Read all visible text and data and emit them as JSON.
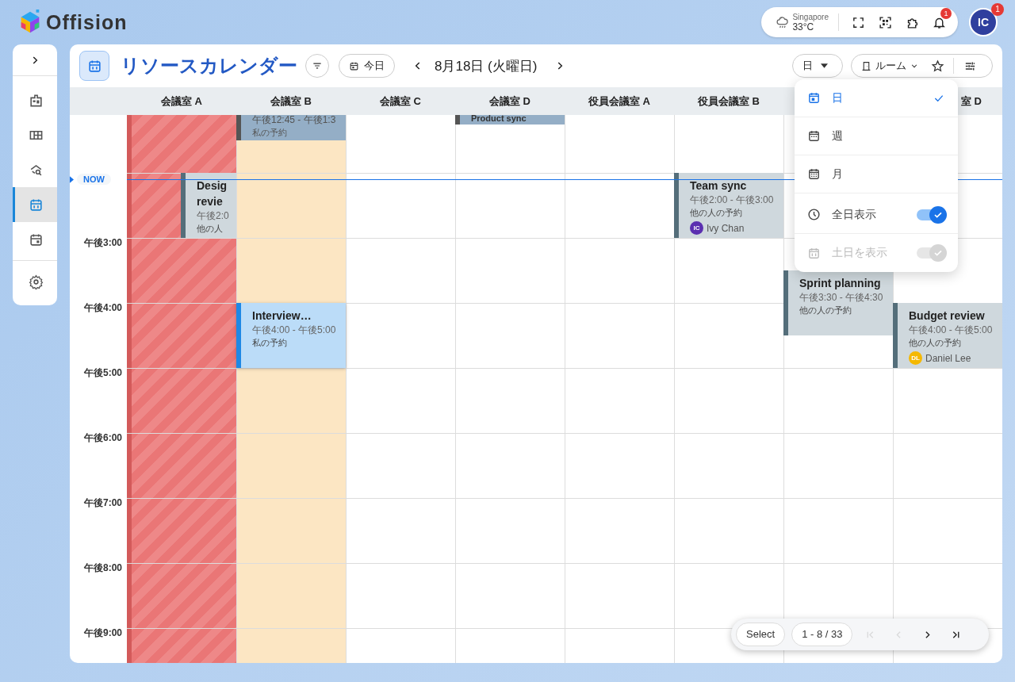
{
  "app": {
    "name": "Offision"
  },
  "weather": {
    "city": "Singapore",
    "temp": "33°C"
  },
  "notifications": {
    "count": "1"
  },
  "user": {
    "initials": "IC",
    "badge": "1"
  },
  "sidebar": {
    "items": [
      {
        "kind": "building",
        "selected": false
      },
      {
        "kind": "floorplan",
        "selected": false
      },
      {
        "kind": "find",
        "selected": false
      },
      {
        "kind": "calendar",
        "selected": true
      },
      {
        "kind": "event",
        "selected": false
      },
      {
        "kind": "settings",
        "selected": false
      }
    ]
  },
  "page": {
    "title": "リソースカレンダー",
    "today": "今日",
    "date": "8月18日 (火曜日)",
    "view": "日",
    "resource": "ルーム"
  },
  "columns": [
    {
      "label": "会議室 A",
      "kind": "blocked"
    },
    {
      "label": "会議室 B",
      "kind": "highlight"
    },
    {
      "label": "会議室 C",
      "kind": "normal"
    },
    {
      "label": "会議室 D",
      "kind": "normal"
    },
    {
      "label": "役員会議室 A",
      "kind": "normal"
    },
    {
      "label": "役員会議室 B",
      "kind": "normal"
    },
    {
      "kind": "normal"
    },
    {
      "label": "室 D",
      "kind": "normal"
    }
  ],
  "times": [
    "午後3:00",
    "午後4:00",
    "午後5:00",
    "午後6:00",
    "午後7:00",
    "午後8:00",
    "午後9:00"
  ],
  "now": "NOW",
  "events": [
    {
      "kind": "past",
      "time": "午後12:45 - 午後1:3",
      "booker": "私の予約"
    },
    {
      "kind": "past",
      "title": "Product sync"
    },
    {
      "kind": "other",
      "title": "Desig revie",
      "time": "午後2:0",
      "booker": "他の人"
    },
    {
      "kind": "other",
      "title": "Team sync",
      "time": "午後2:00 - 午後3:00",
      "booker": "他の人の予約",
      "person": {
        "initials": "IC",
        "name": "Ivy Chan",
        "color": "#5b2fb0"
      }
    },
    {
      "kind": "other",
      "title": "Sprint planning",
      "time": "午後3:30 - 午後4:30",
      "booker": "他の人の予約"
    },
    {
      "kind": "mine",
      "title": "Interview…",
      "time": "午後4:00 - 午後5:00",
      "booker": "私の予約"
    },
    {
      "kind": "other",
      "title": "Budget review",
      "time": "午後4:00 - 午後5:00",
      "booker": "他の人の予約",
      "person": {
        "initials": "DL",
        "name": "Daniel Lee",
        "color": "#f5b800"
      }
    }
  ],
  "view_menu": {
    "items": [
      {
        "kind": "day",
        "label": "日",
        "selected": true
      },
      {
        "kind": "week",
        "label": "週",
        "selected": false
      },
      {
        "kind": "month",
        "label": "月",
        "selected": false
      }
    ],
    "toggles": [
      {
        "kind": "allday",
        "label": "全日表示",
        "on": true,
        "disabled": false
      },
      {
        "kind": "weekend",
        "label": "土日を表示",
        "on": true,
        "disabled": true
      }
    ]
  },
  "pagination": {
    "select": "Select",
    "range": "1 - 8 / 33",
    "buttons": [
      {
        "kind": "first",
        "disabled": true
      },
      {
        "kind": "prev",
        "disabled": true
      },
      {
        "kind": "next",
        "disabled": false
      },
      {
        "kind": "last",
        "disabled": false
      }
    ]
  }
}
